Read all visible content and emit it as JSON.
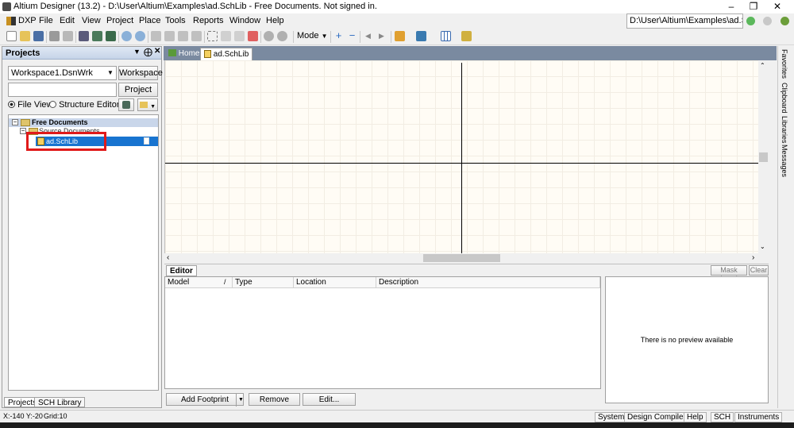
{
  "window": {
    "title": "Altium Designer (13.2) - D:\\User\\Altium\\Examples\\ad.SchLib - Free Documents. Not signed in."
  },
  "menu": {
    "items": [
      "DXP",
      "File",
      "Edit",
      "View",
      "Project",
      "Place",
      "Tools",
      "Reports",
      "Window",
      "Help"
    ]
  },
  "toolbar": {
    "mode_label": "Mode",
    "path_value": "D:\\User\\Altium\\Examples\\ad.Sc"
  },
  "projects_panel": {
    "title": "Projects",
    "workspace_select": "Workspace1.DsnWrk",
    "workspace_button": "Workspace",
    "project_button": "Project",
    "file_view_label": "File View",
    "structure_editor_label": "Structure Editor",
    "tree": {
      "root": "Free Documents",
      "group": "Source Documents",
      "item": "ad.SchLib"
    },
    "bottom_tabs": [
      "Projects",
      "SCH Library"
    ]
  },
  "doc_tabs": [
    "Home",
    "ad.SchLib"
  ],
  "right_sidebar": [
    "Favorites",
    "Clipboard",
    "Libraries",
    "Messages"
  ],
  "editor_panel": {
    "tab_label": "Editor",
    "mask_level_label": "Mask Level",
    "clear_label": "Clear",
    "columns": [
      "Model",
      "Type",
      "Location",
      "Description"
    ],
    "buttons": {
      "add_footprint": "Add Footprint",
      "remove": "Remove",
      "edit": "Edit..."
    },
    "preview_text": "There is no preview available"
  },
  "status_bar": {
    "coords": "X:-140 Y:-20",
    "grid": "Grid:10",
    "buttons": [
      "System",
      "Design Compiler",
      "Help",
      "SCH",
      "Instruments"
    ]
  },
  "colors": {
    "highlight": "#1874d0",
    "annotation": "#e01a1a",
    "canvas": "#fffcf5"
  }
}
